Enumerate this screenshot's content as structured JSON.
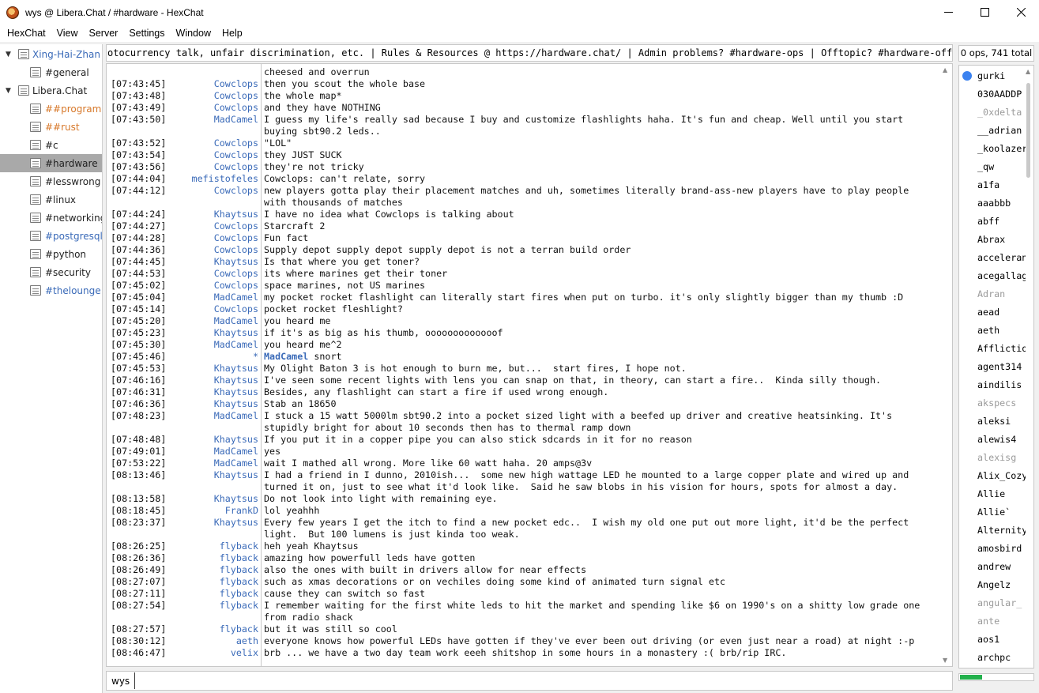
{
  "window": {
    "title": "wys @ Libera.Chat / #hardware - HexChat"
  },
  "menu": [
    "HexChat",
    "View",
    "Server",
    "Settings",
    "Window",
    "Help"
  ],
  "tree": [
    {
      "label": "Xing-Hai-Zhan",
      "type": "network",
      "color": "blue",
      "expanded": true
    },
    {
      "label": "#general",
      "type": "channel",
      "color": "black"
    },
    {
      "label": "Libera.Chat",
      "type": "network",
      "color": "black",
      "expanded": true
    },
    {
      "label": "##programming",
      "type": "channel",
      "color": "orange"
    },
    {
      "label": "##rust",
      "type": "channel",
      "color": "orange"
    },
    {
      "label": "#c",
      "type": "channel",
      "color": "black"
    },
    {
      "label": "#hardware",
      "type": "channel",
      "color": "black",
      "selected": true
    },
    {
      "label": "#lesswrong",
      "type": "channel",
      "color": "black"
    },
    {
      "label": "#linux",
      "type": "channel",
      "color": "black"
    },
    {
      "label": "#networking",
      "type": "channel",
      "color": "black"
    },
    {
      "label": "#postgresql",
      "type": "channel",
      "color": "blue"
    },
    {
      "label": "#python",
      "type": "channel",
      "color": "black"
    },
    {
      "label": "#security",
      "type": "channel",
      "color": "black"
    },
    {
      "label": "#thelounge",
      "type": "channel",
      "color": "blue"
    }
  ],
  "topic": "otocurrency talk, unfair discrimination, etc. | Rules & Resources @ https://hardware.chat/ | Admin problems? #hardware-ops | Offtopic? #hardware-offtopic",
  "user_count": "0 ops, 741 total",
  "messages": [
    {
      "ts": "",
      "nick": "",
      "color": "#3a6ab8",
      "text": "cheesed and overrun"
    },
    {
      "ts": "[07:43:45]",
      "nick": "Cowclops",
      "color": "#3a6ab8",
      "text": "then you scout the whole base"
    },
    {
      "ts": "[07:43:48]",
      "nick": "Cowclops",
      "color": "#3a6ab8",
      "text": "the whole map*"
    },
    {
      "ts": "[07:43:49]",
      "nick": "Cowclops",
      "color": "#3a6ab8",
      "text": "and they have NOTHING"
    },
    {
      "ts": "[07:43:50]",
      "nick": "MadCamel",
      "color": "#3a6ab8",
      "text": "I guess my life's really sad because I buy and customize flashlights haha. It's fun and cheap. Well until you start\nbuying sbt90.2 leds.."
    },
    {
      "ts": "[07:43:52]",
      "nick": "Cowclops",
      "color": "#3a6ab8",
      "text": "\"LOL\""
    },
    {
      "ts": "[07:43:54]",
      "nick": "Cowclops",
      "color": "#3a6ab8",
      "text": "they JUST SUCK"
    },
    {
      "ts": "[07:43:56]",
      "nick": "Cowclops",
      "color": "#3a6ab8",
      "text": "they're not tricky"
    },
    {
      "ts": "[07:44:04]",
      "nick": "mefistofeles",
      "color": "#3a6ab8",
      "text": "Cowclops: can't relate, sorry"
    },
    {
      "ts": "[07:44:12]",
      "nick": "Cowclops",
      "color": "#3a6ab8",
      "text": "new players gotta play their placement matches and uh, sometimes literally brand-ass-new players have to play people\nwith thousands of matches"
    },
    {
      "ts": "[07:44:24]",
      "nick": "Khaytsus",
      "color": "#3a6ab8",
      "text": "I have no idea what Cowclops is talking about"
    },
    {
      "ts": "[07:44:27]",
      "nick": "Cowclops",
      "color": "#3a6ab8",
      "text": "Starcraft 2"
    },
    {
      "ts": "[07:44:28]",
      "nick": "Cowclops",
      "color": "#3a6ab8",
      "text": "Fun fact"
    },
    {
      "ts": "[07:44:36]",
      "nick": "Cowclops",
      "color": "#3a6ab8",
      "text": "Supply depot supply depot supply depot is not a terran build order"
    },
    {
      "ts": "[07:44:45]",
      "nick": "Khaytsus",
      "color": "#3a6ab8",
      "text": "Is that where you get toner?"
    },
    {
      "ts": "[07:44:53]",
      "nick": "Cowclops",
      "color": "#3a6ab8",
      "text": "its where marines get their toner"
    },
    {
      "ts": "[07:45:02]",
      "nick": "Cowclops",
      "color": "#3a6ab8",
      "text": "space marines, not US marines"
    },
    {
      "ts": "[07:45:04]",
      "nick": "MadCamel",
      "color": "#3a6ab8",
      "text": "my pocket rocket flashlight can literally start fires when put on turbo. it's only slightly bigger than my thumb :D"
    },
    {
      "ts": "[07:45:14]",
      "nick": "Cowclops",
      "color": "#3a6ab8",
      "text": "pocket rocket fleshlight?"
    },
    {
      "ts": "[07:45:20]",
      "nick": "MadCamel",
      "color": "#3a6ab8",
      "text": "you heard me"
    },
    {
      "ts": "[07:45:23]",
      "nick": "Khaytsus",
      "color": "#3a6ab8",
      "text": "if it's as big as his thumb, ooooooooooooof"
    },
    {
      "ts": "[07:45:30]",
      "nick": "MadCamel",
      "color": "#3a6ab8",
      "text": "you heard me^2"
    },
    {
      "ts": "[07:45:46]",
      "nick": "*",
      "color": "#3a6ab8",
      "action_nick": "MadCamel",
      "text": " snort"
    },
    {
      "ts": "[07:45:53]",
      "nick": "Khaytsus",
      "color": "#3a6ab8",
      "text": "My Olight Baton 3 is hot enough to burn me, but...  start fires, I hope not."
    },
    {
      "ts": "[07:46:16]",
      "nick": "Khaytsus",
      "color": "#3a6ab8",
      "text": "I've seen some recent lights with lens you can snap on that, in theory, can start a fire..  Kinda silly though."
    },
    {
      "ts": "[07:46:31]",
      "nick": "Khaytsus",
      "color": "#3a6ab8",
      "text": "Besides, any flashlight can start a fire if used wrong enough."
    },
    {
      "ts": "[07:46:36]",
      "nick": "Khaytsus",
      "color": "#3a6ab8",
      "text": "Stab an 18650"
    },
    {
      "ts": "[07:48:23]",
      "nick": "MadCamel",
      "color": "#3a6ab8",
      "text": "I stuck a 15 watt 5000lm sbt90.2 into a pocket sized light with a beefed up driver and creative heatsinking. It's\nstupidly bright for about 10 seconds then has to thermal ramp down"
    },
    {
      "ts": "[07:48:48]",
      "nick": "Khaytsus",
      "color": "#3a6ab8",
      "text": "If you put it in a copper pipe you can also stick sdcards in it for no reason"
    },
    {
      "ts": "[07:49:01]",
      "nick": "MadCamel",
      "color": "#3a6ab8",
      "text": "yes"
    },
    {
      "ts": "[07:53:22]",
      "nick": "MadCamel",
      "color": "#3a6ab8",
      "text": "wait I mathed all wrong. More like 60 watt haha. 20 amps@3v"
    },
    {
      "ts": "[08:13:46]",
      "nick": "Khaytsus",
      "color": "#3a6ab8",
      "text": "I had a friend in I dunno, 2010ish...  some new high wattage LED he mounted to a large copper plate and wired up and\nturned it on, just to see what it'd look like.  Said he saw blobs in his vision for hours, spots for almost a day."
    },
    {
      "ts": "[08:13:58]",
      "nick": "Khaytsus",
      "color": "#3a6ab8",
      "text": "Do not look into light with remaining eye."
    },
    {
      "ts": "[08:18:45]",
      "nick": "FrankD",
      "color": "#3a6ab8",
      "text": "lol yeahhh"
    },
    {
      "ts": "[08:23:37]",
      "nick": "Khaytsus",
      "color": "#3a6ab8",
      "text": "Every few years I get the itch to find a new pocket edc..  I wish my old one put out more light, it'd be the perfect\nlight.  But 100 lumens is just kinda too weak."
    },
    {
      "ts": "[08:26:25]",
      "nick": "flyback",
      "color": "#3a6ab8",
      "text": "heh yeah Khaytsus"
    },
    {
      "ts": "[08:26:36]",
      "nick": "flyback",
      "color": "#3a6ab8",
      "text": "amazing how powerfull leds have gotten"
    },
    {
      "ts": "[08:26:49]",
      "nick": "flyback",
      "color": "#3a6ab8",
      "text": "also the ones with built in drivers allow for near effects"
    },
    {
      "ts": "[08:27:07]",
      "nick": "flyback",
      "color": "#3a6ab8",
      "text": "such as xmas decorations or on vechiles doing some kind of animated turn signal etc"
    },
    {
      "ts": "[08:27:11]",
      "nick": "flyback",
      "color": "#3a6ab8",
      "text": "cause they can switch so fast"
    },
    {
      "ts": "[08:27:54]",
      "nick": "flyback",
      "color": "#3a6ab8",
      "text": "I remember waiting for the first white leds to hit the market and spending like $6 on 1990's on a shitty low grade one\nfrom radio shack"
    },
    {
      "ts": "[08:27:57]",
      "nick": "flyback",
      "color": "#3a6ab8",
      "text": "but it was still so cool"
    },
    {
      "ts": "[08:30:12]",
      "nick": "aeth",
      "color": "#3a6ab8",
      "text": "everyone knows how powerful LEDs have gotten if they've ever been out driving (or even just near a road) at night :-p"
    },
    {
      "ts": "[08:46:47]",
      "nick": "velix",
      "color": "#3a6ab8",
      "text": "brb ... we have a two day team work eeeh shitshop in some hours in a monastery :( brb/rip IRC."
    }
  ],
  "input": {
    "nick": "wys",
    "value": ""
  },
  "users": [
    {
      "name": "gurki",
      "op": true
    },
    {
      "name": "030AADDP"
    },
    {
      "name": "_0xdelta",
      "away": true
    },
    {
      "name": "__adrian"
    },
    {
      "name": "_koolazer"
    },
    {
      "name": "_qw"
    },
    {
      "name": "a1fa"
    },
    {
      "name": "aaabbb"
    },
    {
      "name": "abff"
    },
    {
      "name": "Abrax"
    },
    {
      "name": "accelerando"
    },
    {
      "name": "acegallagher"
    },
    {
      "name": "Adran",
      "away": true
    },
    {
      "name": "aead"
    },
    {
      "name": "aeth"
    },
    {
      "name": "Affliction"
    },
    {
      "name": "agent314"
    },
    {
      "name": "aindilis"
    },
    {
      "name": "akspecs",
      "away": true
    },
    {
      "name": "aleksi"
    },
    {
      "name": "alewis4"
    },
    {
      "name": "alexisg",
      "away": true
    },
    {
      "name": "Alix_Cozy"
    },
    {
      "name": "Allie"
    },
    {
      "name": "Allie`"
    },
    {
      "name": "Alternity"
    },
    {
      "name": "amosbird"
    },
    {
      "name": "andrew"
    },
    {
      "name": "Angelz"
    },
    {
      "name": "angular_",
      "away": true
    },
    {
      "name": "ante",
      "away": true
    },
    {
      "name": "aos1"
    },
    {
      "name": "archpc"
    }
  ],
  "lag_fraction": 0.3,
  "colors": {
    "selected_row": "#a9a9a9",
    "nick": "#3a6ab8",
    "op_dot": "#3b82f0",
    "lag": "#22b14c"
  }
}
